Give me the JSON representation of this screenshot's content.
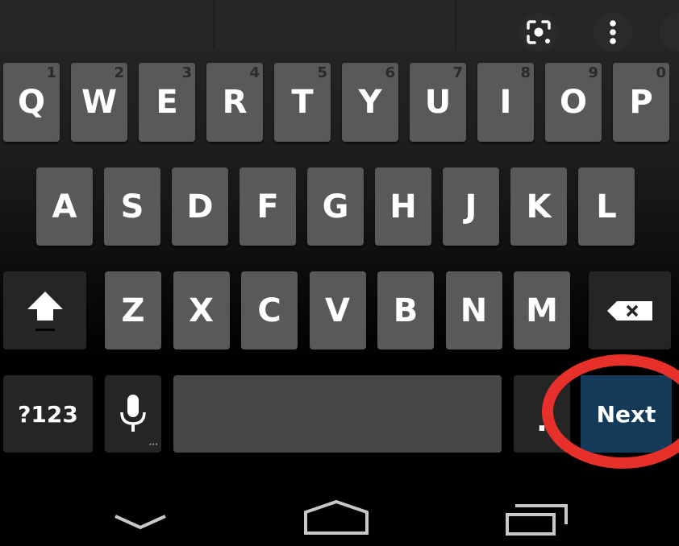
{
  "suggestion_strip": {
    "lens_icon": "google-lens-icon",
    "more_icon": "more-vertical-icon"
  },
  "keyboard": {
    "row1": [
      {
        "label": "Q",
        "hint": "1"
      },
      {
        "label": "W",
        "hint": "2"
      },
      {
        "label": "E",
        "hint": "3"
      },
      {
        "label": "R",
        "hint": "4"
      },
      {
        "label": "T",
        "hint": "5"
      },
      {
        "label": "Y",
        "hint": "6"
      },
      {
        "label": "U",
        "hint": "7"
      },
      {
        "label": "I",
        "hint": "8"
      },
      {
        "label": "O",
        "hint": "9"
      },
      {
        "label": "P",
        "hint": "0"
      }
    ],
    "row2": [
      "A",
      "S",
      "D",
      "F",
      "G",
      "H",
      "J",
      "K",
      "L"
    ],
    "row3": [
      "Z",
      "X",
      "C",
      "V",
      "B",
      "N",
      "M"
    ],
    "shift_icon": "shift-arrow-icon",
    "backspace_icon": "backspace-icon",
    "symbols_label": "?123",
    "mic_icon": "microphone-icon",
    "space_label": "",
    "period_label": ".",
    "action_label": "Next",
    "action_color": "#143a5a",
    "highlight_color": "#e8302a"
  },
  "nav_bar": {
    "back_icon": "chevron-down-icon",
    "home_icon": "home-icon",
    "recents_icon": "recents-icon"
  }
}
